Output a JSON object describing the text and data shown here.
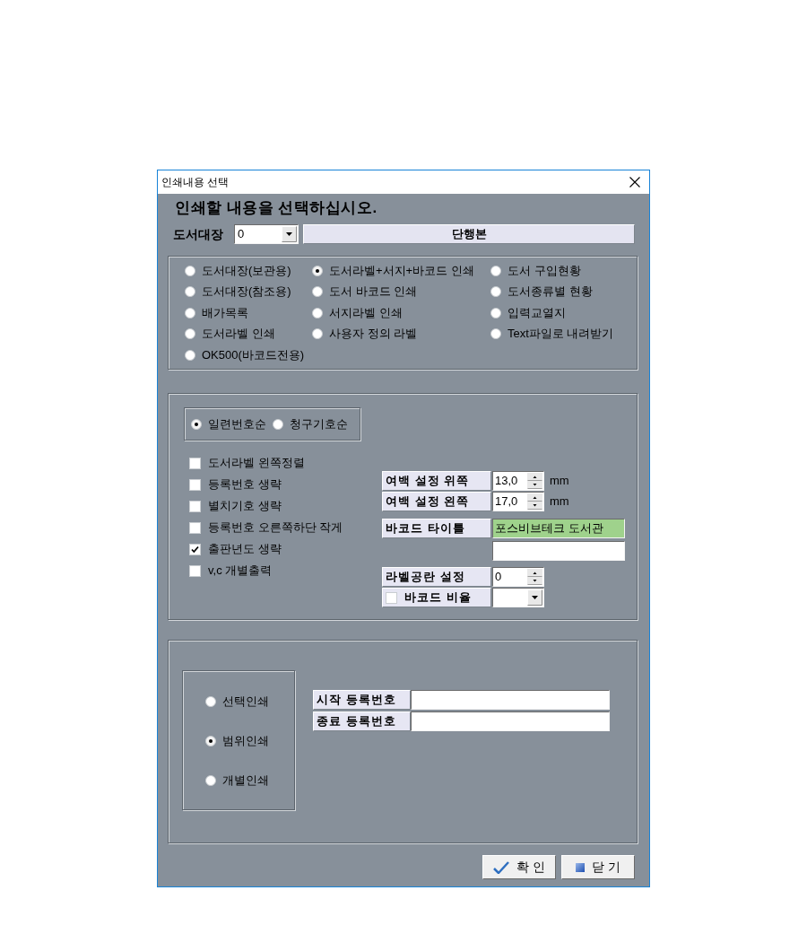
{
  "window": {
    "title": "인쇄내용 선택"
  },
  "heading": "인쇄할 내용을 선택하십시오.",
  "ledger": {
    "label": "도서대장",
    "value": "0",
    "book_type": "단행본"
  },
  "print_types": [
    {
      "label": "도서대장(보관용)",
      "selected": false
    },
    {
      "label": "도서라벨+서지+바코드 인쇄",
      "selected": true
    },
    {
      "label": "도서 구입현황",
      "selected": false
    },
    {
      "label": "도서대장(참조용)",
      "selected": false
    },
    {
      "label": "도서 바코드 인쇄",
      "selected": false
    },
    {
      "label": "도서종류별 현황",
      "selected": false
    },
    {
      "label": "배가목록",
      "selected": false
    },
    {
      "label": "서지라벨 인쇄",
      "selected": false
    },
    {
      "label": "입력교열지",
      "selected": false
    },
    {
      "label": "도서라벨 인쇄",
      "selected": false
    },
    {
      "label": "사용자 정의 라벨",
      "selected": false
    },
    {
      "label": "Text파일로 내려받기",
      "selected": false
    },
    {
      "label": "OK500(바코드전용)",
      "selected": false
    }
  ],
  "sort_order": [
    {
      "label": "일련번호순",
      "selected": true
    },
    {
      "label": "청구기호순",
      "selected": false
    }
  ],
  "options": [
    {
      "label": "도서라벨 왼쪽정렬",
      "checked": false
    },
    {
      "label": "등록번호 생략",
      "checked": false
    },
    {
      "label": "별치기호 생략",
      "checked": false
    },
    {
      "label": "등록번호 오른쪽하단 작게",
      "checked": false
    },
    {
      "label": "출판년도 생략",
      "checked": true
    },
    {
      "label": "v,c 개별출력",
      "checked": false
    }
  ],
  "margins": [
    {
      "label": "여백 설정 위쪽",
      "value": "13,0",
      "unit": "mm"
    },
    {
      "label": "여백 설정 왼쪽",
      "value": "17,0",
      "unit": "mm"
    }
  ],
  "barcode_title": {
    "label": "바코드 타이틀",
    "value": "포스비브테크 도서관"
  },
  "blank_labels": {
    "label": "라벨공란 설정",
    "value": "0"
  },
  "barcode_ratio": {
    "label": "바코드 비율",
    "checked": false
  },
  "print_range": [
    {
      "label": "선택인쇄",
      "selected": false
    },
    {
      "label": "범위인쇄",
      "selected": true
    },
    {
      "label": "개별인쇄",
      "selected": false
    }
  ],
  "registration_range": [
    {
      "label": "시작 등록번호"
    },
    {
      "label": "종료 등록번호"
    }
  ],
  "buttons": [
    {
      "label": "확 인",
      "kind": "confirm"
    },
    {
      "label": "닫 기",
      "kind": "close"
    }
  ]
}
